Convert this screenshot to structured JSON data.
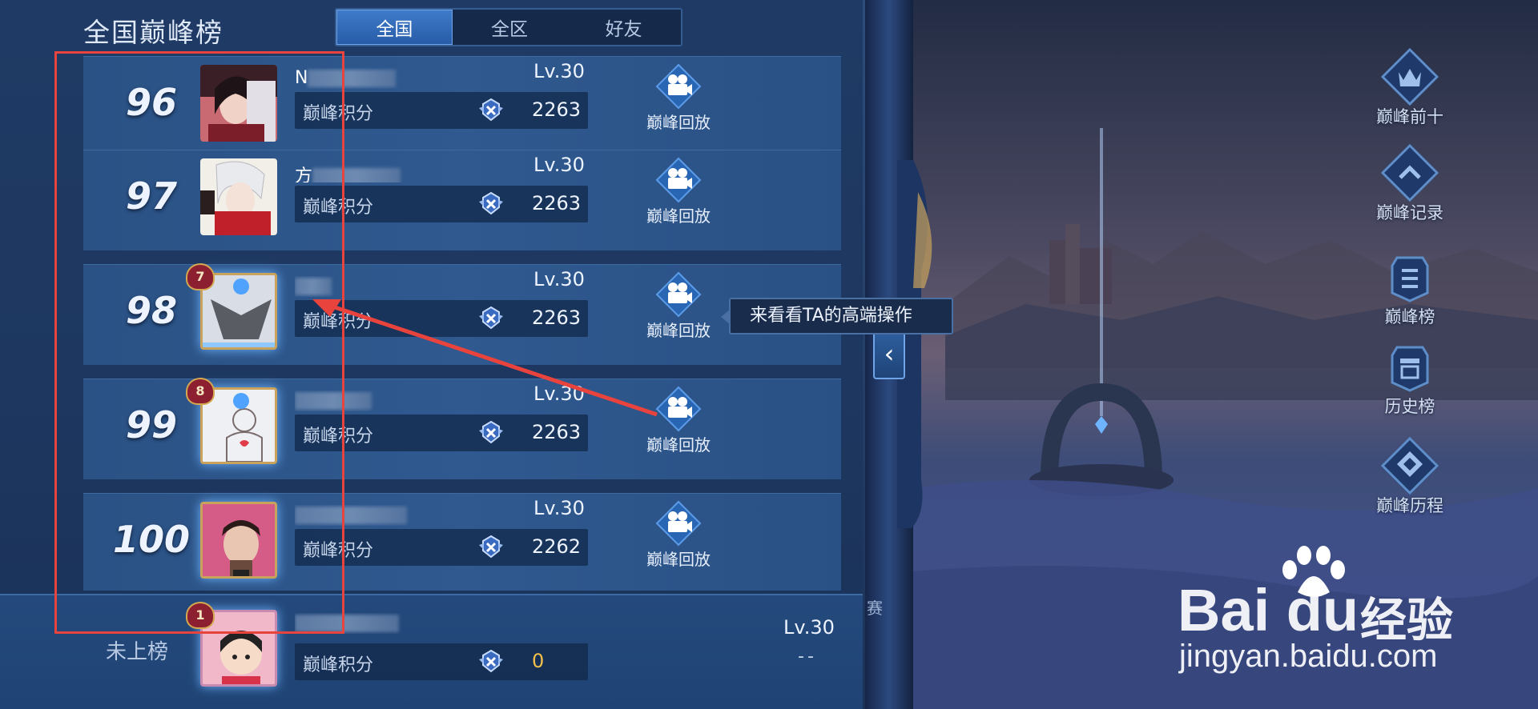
{
  "header": {
    "title": "全国巅峰榜",
    "tabs": [
      {
        "label": "全国",
        "active": true
      },
      {
        "label": "全区",
        "active": false
      },
      {
        "label": "好友",
        "active": false
      }
    ]
  },
  "ranking": {
    "score_label": "巅峰积分",
    "replay_label": "巅峰回放",
    "rows": [
      {
        "rank": "96",
        "name": "N",
        "level": "Lv.30",
        "score": "2263"
      },
      {
        "rank": "97",
        "name": "方",
        "level": "Lv.30",
        "score": "2263"
      },
      {
        "rank": "98",
        "name": "",
        "level": "Lv.30",
        "score": "2263",
        "badge": "7"
      },
      {
        "rank": "99",
        "name": "",
        "level": "Lv.30",
        "score": "2263",
        "badge": "8"
      },
      {
        "rank": "100",
        "name": "",
        "level": "Lv.30",
        "score": "2262"
      }
    ]
  },
  "self_row": {
    "rank_text": "未上榜",
    "name": "",
    "level": "Lv.30",
    "score_label": "巅峰积分",
    "score": "0",
    "badge": "1",
    "extra": "--"
  },
  "tooltip": "来看看TA的高端操作",
  "side_tag": "赛",
  "side_menu": [
    {
      "label": "巅峰前十",
      "icon": "crown-shield-icon"
    },
    {
      "label": "巅峰记录",
      "icon": "chevron-up-shield-icon"
    },
    {
      "label": "巅峰榜",
      "icon": "list-shield-icon"
    },
    {
      "label": "历史榜",
      "icon": "history-shield-icon"
    },
    {
      "label": "巅峰历程",
      "icon": "diamond-shield-icon"
    }
  ],
  "colors": {
    "accent": "#3f7bc9",
    "score_zero": "#f2c04a",
    "annotation": "#e8433d"
  },
  "watermark": {
    "brand": "Bai du",
    "cn": "经验",
    "url": "jingyan.baidu.com"
  }
}
